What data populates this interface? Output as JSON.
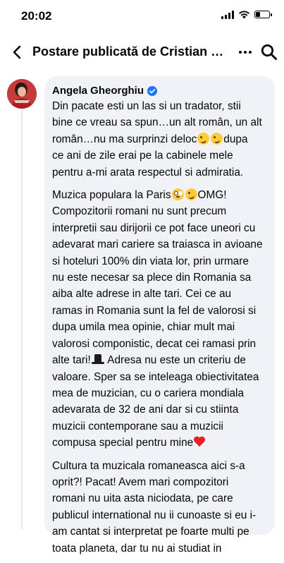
{
  "status_bar": {
    "time": "20:02",
    "battery_percent": 35,
    "icons": [
      "signal-icon",
      "wifi-icon",
      "battery-icon"
    ]
  },
  "nav": {
    "title": "Postare publicată de Cristian M...",
    "icons": [
      "back-arrow-icon",
      "more-options-icon",
      "search-icon"
    ]
  },
  "comment": {
    "author": "Angela Gheorghiu",
    "verified": true,
    "avatar_color": "#c73a3a",
    "paragraphs": [
      {
        "lines": [
          "Din pacate esti un las si un tradator, stii",
          "bine ce vreau sa spun…un alt român, un alt",
          "român…nu ma surprinzi deloc",
          "dupa",
          "ce ani de zile erai pe la cabinele mele",
          "pentru a-mi arata respectul si admiratia."
        ]
      },
      {
        "lines": [
          "Muzica populara la Paris",
          "OMG!",
          "Compozitorii romani  nu sunt precum",
          "interpretii sau dirijorii ce pot face uneori cu",
          "adevarat mari cariere sa traiasca in avioane",
          "si hoteluri 100% din viata lor, prin urmare",
          "nu este necesar sa plece din Romania sa",
          "aiba alte adrese in alte tari. Cei ce au",
          "ramas in Romania sunt la fel de valorosi si",
          "dupa umila mea opinie, chiar mult mai",
          "valorosi componistic, decat cei ramasi prin",
          "alte tari!",
          " Adresa nu este un criteriu de",
          "valoare. Sper sa se inteleaga obiectivitatea",
          "mea de muzician, cu o cariera mondiala",
          "adevarata de 32 de ani dar si cu stiinta",
          "muzicii contemporane sau a muzicii",
          "compusa special pentru mine"
        ]
      },
      {
        "lines": [
          "Cultura ta muzicala romaneasca aici s-a",
          "oprit?! Pacat! Avem mari compozitori",
          "romani nu uita asta niciodata, pe care",
          "publicul international nu ii cunoaste si eu i-",
          "am cantat si interpretat pe foarte multi pe",
          "toata planeta, dar tu nu ai studiat in"
        ]
      }
    ]
  },
  "colors": {
    "bubble_bg": "#f0f2f5",
    "verified_blue": "#1877f2",
    "thread_line": "#e4e6eb"
  }
}
